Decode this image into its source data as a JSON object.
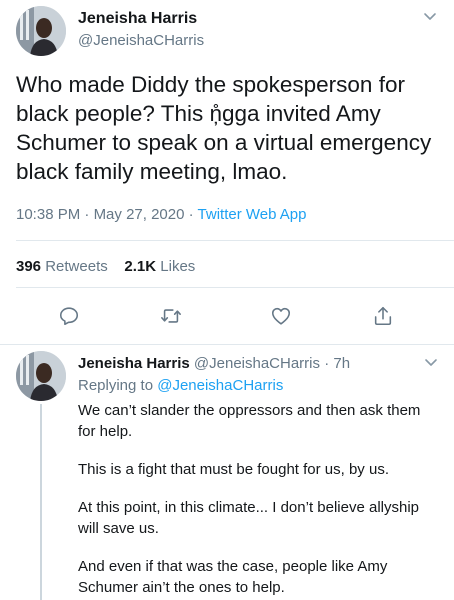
{
  "tweet": {
    "name": "Jeneisha Harris",
    "handle": "@JeneishaCHarris",
    "text": "Who made Diddy the spokesperson for black people? This ņ̊gga invited Amy Schumer to speak on a virtual emergency black family meeting, lmao.",
    "time": "10:38 PM",
    "date": "May 27, 2020",
    "source": "Twitter Web App",
    "separator": "·",
    "retweets_count": "396",
    "retweets_label": "Retweets",
    "likes_count": "2.1K",
    "likes_label": "Likes"
  },
  "icons": {
    "reply": "reply-icon",
    "retweet": "retweet-icon",
    "like": "heart-icon",
    "share": "share-icon",
    "more": "chevron-down-icon"
  },
  "reply": {
    "name": "Jeneisha Harris",
    "handle": "@JeneishaCHarris",
    "separator": "·",
    "time": "7h",
    "replying_prefix": "Replying to",
    "replying_handle": "@JeneishaCHarris",
    "paragraphs": [
      "We can’t slander the oppressors and then ask them for help.",
      "This is a fight that must be fought for us, by us.",
      "At this point, in this climate... I don’t believe allyship will save us.",
      "And even if that was the case, people like Amy Schumer ain’t the ones to help."
    ]
  },
  "colors": {
    "accent": "#1da1f2",
    "secondary_text": "#657786",
    "primary_text": "#14171a",
    "divider": "#e1e8ed"
  }
}
